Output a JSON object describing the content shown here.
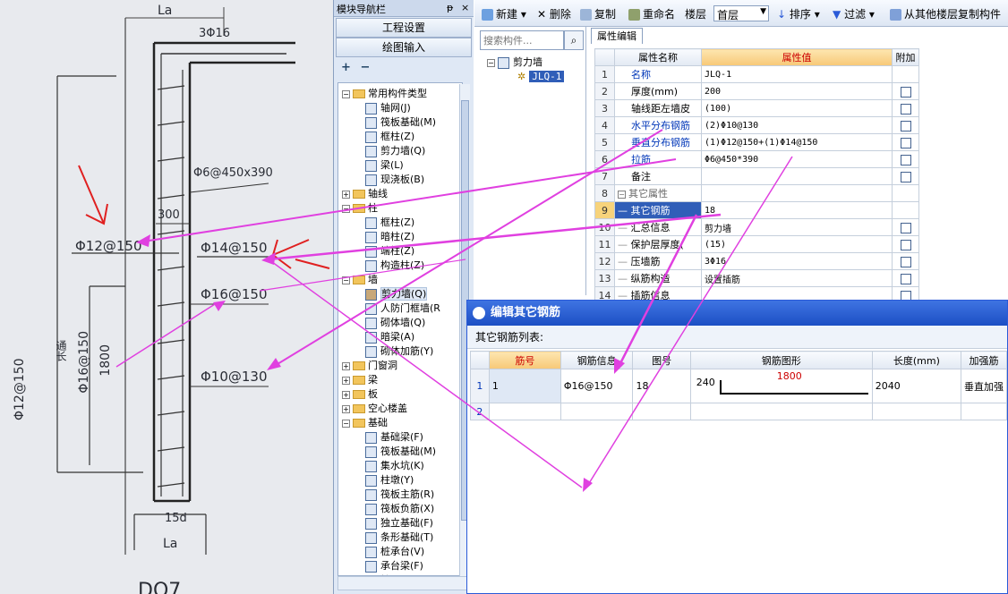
{
  "photo": {
    "labels": {
      "la_top": "La",
      "bars_top": "3Φ16",
      "tie": "Φ6@450x390",
      "spacing": "300",
      "h_left": "Φ12@150",
      "h_right": "Φ14@150",
      "v_right": "Φ16@150",
      "v_bottom": "Φ10@130",
      "dim_left": "Φ12@150",
      "dim_left2": "通长",
      "dim_mid": "Φ16@150",
      "dim_1800": "1800",
      "bottom_15d": "15d",
      "bottom_la": "La",
      "bottom_code": "DQ7"
    }
  },
  "nav": {
    "title": "模块导航栏",
    "pin": "ᵽ",
    "close": "×",
    "buttons": [
      "工程设置",
      "绘图输入"
    ],
    "tree_tools": [
      "+",
      "−"
    ],
    "tree": [
      {
        "label": "常用构件类型",
        "level": 0,
        "expand": "−"
      },
      {
        "label": "轴网(J)",
        "level": 1
      },
      {
        "label": "筏板基础(M)",
        "level": 1
      },
      {
        "label": "框柱(Z)",
        "level": 1
      },
      {
        "label": "剪力墙(Q)",
        "level": 1
      },
      {
        "label": "梁(L)",
        "level": 1
      },
      {
        "label": "现浇板(B)",
        "level": 1
      },
      {
        "label": "轴线",
        "level": 0,
        "expand": "+"
      },
      {
        "label": "柱",
        "level": 0,
        "expand": "−"
      },
      {
        "label": "框柱(Z)",
        "level": 1
      },
      {
        "label": "暗柱(Z)",
        "level": 1
      },
      {
        "label": "端柱(Z)",
        "level": 1
      },
      {
        "label": "构造柱(Z)",
        "level": 1
      },
      {
        "label": "墙",
        "level": 0,
        "expand": "−"
      },
      {
        "label": "剪力墙(Q)",
        "level": 1,
        "selected": true
      },
      {
        "label": "人防门框墙(R",
        "level": 1
      },
      {
        "label": "砌体墙(Q)",
        "level": 1
      },
      {
        "label": "暗梁(A)",
        "level": 1
      },
      {
        "label": "砌体加筋(Y)",
        "level": 1
      },
      {
        "label": "门窗洞",
        "level": 0,
        "expand": "+"
      },
      {
        "label": "梁",
        "level": 0,
        "expand": "+"
      },
      {
        "label": "板",
        "level": 0,
        "expand": "+"
      },
      {
        "label": "空心楼盖",
        "level": 0,
        "expand": "+"
      },
      {
        "label": "基础",
        "level": 0,
        "expand": "−"
      },
      {
        "label": "基础梁(F)",
        "level": 1
      },
      {
        "label": "筏板基础(M)",
        "level": 1
      },
      {
        "label": "集水坑(K)",
        "level": 1
      },
      {
        "label": "柱墩(Y)",
        "level": 1
      },
      {
        "label": "筏板主筋(R)",
        "level": 1
      },
      {
        "label": "筏板负筋(X)",
        "level": 1
      },
      {
        "label": "独立基础(F)",
        "level": 1
      },
      {
        "label": "条形基础(T)",
        "level": 1
      },
      {
        "label": "桩承台(V)",
        "level": 1
      },
      {
        "label": "承台梁(F)",
        "level": 1
      },
      {
        "label": "桩(U)",
        "level": 1
      }
    ]
  },
  "toolbar": {
    "new": "新建",
    "delete": "删除",
    "copy": "复制",
    "rename": "重命名",
    "floor_label": "楼层",
    "floor_value": "首层",
    "sort": "排序",
    "filter": "过滤",
    "copy_from": "从其他楼层复制构件"
  },
  "search": {
    "placeholder": "搜索构件..."
  },
  "component_tree": {
    "root": "剪力墙",
    "child": "JLQ-1"
  },
  "props": {
    "tab": "属性编辑",
    "headers": [
      "属性名称",
      "属性值",
      "附加"
    ],
    "rows": [
      {
        "n": "1",
        "name": "名称",
        "value": "JLQ-1",
        "blue": true,
        "check": false
      },
      {
        "n": "2",
        "name": "厚度(mm)",
        "value": "200",
        "check": true
      },
      {
        "n": "3",
        "name": "轴线距左墙皮",
        "value": "(100)",
        "check": true
      },
      {
        "n": "4",
        "name": "水平分布钢筋",
        "value": "(2)Φ10@130",
        "blue": true,
        "check": true
      },
      {
        "n": "5",
        "name": "垂直分布钢筋",
        "value": "(1)Φ12@150+(1)Φ14@150",
        "blue": true,
        "check": true
      },
      {
        "n": "6",
        "name": "拉筋",
        "value": "Φ6@450*390",
        "blue": true,
        "check": true
      },
      {
        "n": "7",
        "name": "备注",
        "value": "",
        "check": true
      },
      {
        "n": "8",
        "name": "其它属性",
        "value": "",
        "group": true
      },
      {
        "n": "9",
        "name": "其它钢筋",
        "value": "18",
        "selected": true
      },
      {
        "n": "10",
        "name": "汇总信息",
        "value": "剪力墙",
        "check": true
      },
      {
        "n": "11",
        "name": "保护层厚度(",
        "value": "(15)",
        "check": true
      },
      {
        "n": "12",
        "name": "压墙筋",
        "value": "3Φ16",
        "check": true
      },
      {
        "n": "13",
        "name": "纵筋构造",
        "value": "设置插筋",
        "check": true
      },
      {
        "n": "14",
        "name": "插筋信息",
        "value": "",
        "check": true
      }
    ]
  },
  "dialog": {
    "title": "编辑其它钢筋",
    "subtitle": "其它钢筋列表:",
    "headers": [
      "筋号",
      "钢筋信息",
      "图号",
      "钢筋图形",
      "长度(mm)",
      "加强筋"
    ],
    "rows": [
      {
        "n": "1",
        "no": "1",
        "info": "Φ16@150",
        "fig": "18",
        "shape_start": "240",
        "shape_len": "1800",
        "length": "2040",
        "type": "垂直加强"
      },
      {
        "n": "2",
        "no": "",
        "info": "",
        "fig": "",
        "shape_start": "",
        "shape_len": "",
        "length": "",
        "type": ""
      }
    ]
  },
  "colors": {
    "annotation": "#e040e0",
    "photo_arrow": "#e02020",
    "title_blue": "#1c4fc4"
  }
}
